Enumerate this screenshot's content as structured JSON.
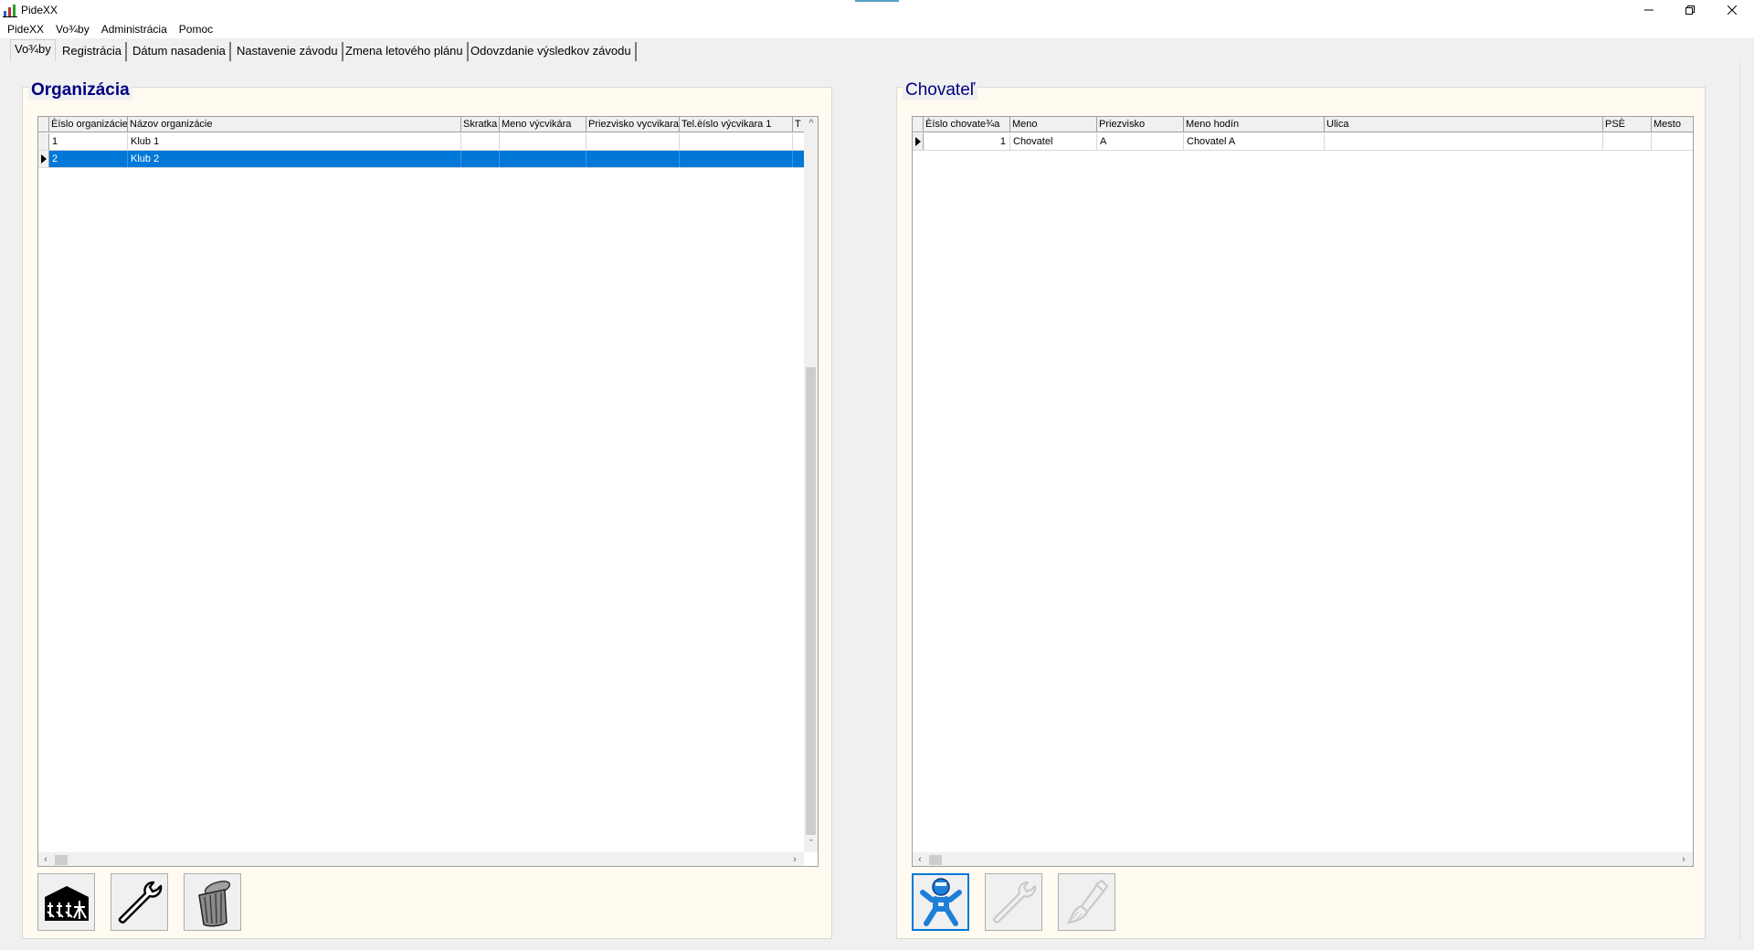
{
  "window": {
    "title": "PideXX"
  },
  "menu": {
    "items": [
      "PideXX",
      "Vo¾by",
      "Administrácia",
      "Pomoc"
    ]
  },
  "tabs": [
    "Vo¾by",
    "Registrácia",
    "Dátum nasadenia",
    "Nastavenie závodu",
    "Zmena letového plánu",
    "Odovzdanie výsledkov závodu"
  ],
  "organizacia": {
    "title": "Organizácia",
    "columns": [
      "Èíslo organizácie",
      "Názov organizácie",
      "Skratka",
      "Meno výcvikára",
      "Priezvisko vycvikara",
      "Tel.èíslo výcvikara 1",
      "T"
    ],
    "rows": [
      [
        "1",
        "Klub 1",
        "",
        "",
        "",
        "",
        ""
      ],
      [
        "2",
        "Klub 2",
        "",
        "",
        "",
        "",
        ""
      ]
    ],
    "selected_row": 1,
    "buttons": {
      "add": "add-organization-icon",
      "edit": "wrench-icon",
      "delete": "trash-can-icon"
    }
  },
  "chovatel": {
    "title": "Chovateľ",
    "columns": [
      "Èíslo chovate¾a",
      "Meno",
      "Priezvisko",
      "Meno hodín",
      "Ulica",
      "PSÈ",
      "Mesto"
    ],
    "rows": [
      [
        "1",
        "Chovatel",
        "A",
        "Chovatel A",
        "",
        "",
        ""
      ]
    ],
    "current_row": 0,
    "buttons": {
      "add": "person-icon",
      "edit": "wrench-disabled-icon",
      "delete": "brush-disabled-icon"
    }
  },
  "colors": {
    "selection": "#0078d7",
    "panel_bg": "#fffbf0",
    "title_color": "#000080"
  }
}
